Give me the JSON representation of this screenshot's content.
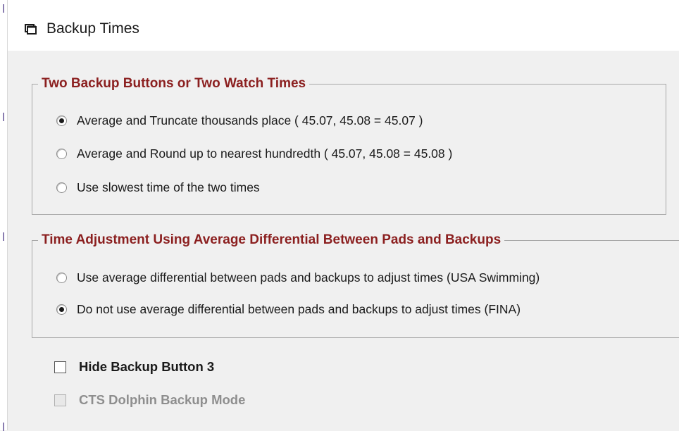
{
  "window": {
    "title": "Backup Times",
    "icon": "window-icon"
  },
  "groups": [
    {
      "label": "Two Backup Buttons or Two Watch Times",
      "options": [
        {
          "label": "Average and Truncate thousands place  ( 45.07, 45.08 = 45.07 )",
          "selected": true
        },
        {
          "label": "Average and Round up to nearest hundredth  ( 45.07, 45.08 = 45.08 )",
          "selected": false
        },
        {
          "label": "Use slowest time of the two times",
          "selected": false
        }
      ]
    },
    {
      "label": "Time Adjustment Using Average Differential Between Pads and Backups",
      "options": [
        {
          "label": "Use average differential between pads and backups to adjust times (USA Swimming)",
          "selected": false
        },
        {
          "label": "Do not use average differential between pads and backups to adjust times (FINA)",
          "selected": true
        }
      ]
    }
  ],
  "checkboxes": [
    {
      "label": "Hide Backup Button 3",
      "checked": false,
      "enabled": true
    },
    {
      "label": "CTS Dolphin Backup Mode",
      "checked": false,
      "enabled": false
    }
  ],
  "colors": {
    "group_label": "#8b1f1f",
    "background": "#f0f0f0",
    "disabled_text": "#8e8e8e"
  }
}
